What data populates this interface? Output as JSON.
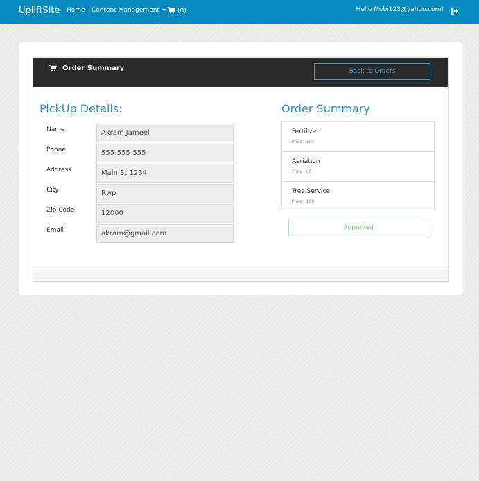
{
  "navbar": {
    "brand": "UpliftSite",
    "home": "Home",
    "content_management": "Content Management",
    "cart_count": "(0)",
    "greeting": "Hello Mobi123@yahoo.com!"
  },
  "panel": {
    "title": "Order Summary",
    "back_button": "Back to Orders"
  },
  "pickup": {
    "title": "PickUp Details:",
    "fields": [
      {
        "label": "Name",
        "value": "Akram Jameel"
      },
      {
        "label": "Phone",
        "value": "555-555-555"
      },
      {
        "label": "Address",
        "value": "Main St 1234"
      },
      {
        "label": "City",
        "value": "Rwp"
      },
      {
        "label": "Zip Code",
        "value": "12000"
      },
      {
        "label": "Email",
        "value": "akram@gmail.com"
      }
    ]
  },
  "summary": {
    "title": "Order Summary",
    "items": [
      {
        "name": "Fertilizer",
        "price": "Price : 100"
      },
      {
        "name": "Aeriation",
        "price": "Price : 60"
      },
      {
        "name": "Tree Service",
        "price": "Price : 100"
      }
    ],
    "status_button": "Approved"
  },
  "icons": {
    "cart": "cart-icon",
    "signout": "sign-out-icon",
    "caret": "caret-down-icon"
  },
  "colors": {
    "navbar": "#0a8bbf",
    "panel_header": "#2b2b2b",
    "accent": "#2f8fc7",
    "approved": "#7cc790"
  }
}
